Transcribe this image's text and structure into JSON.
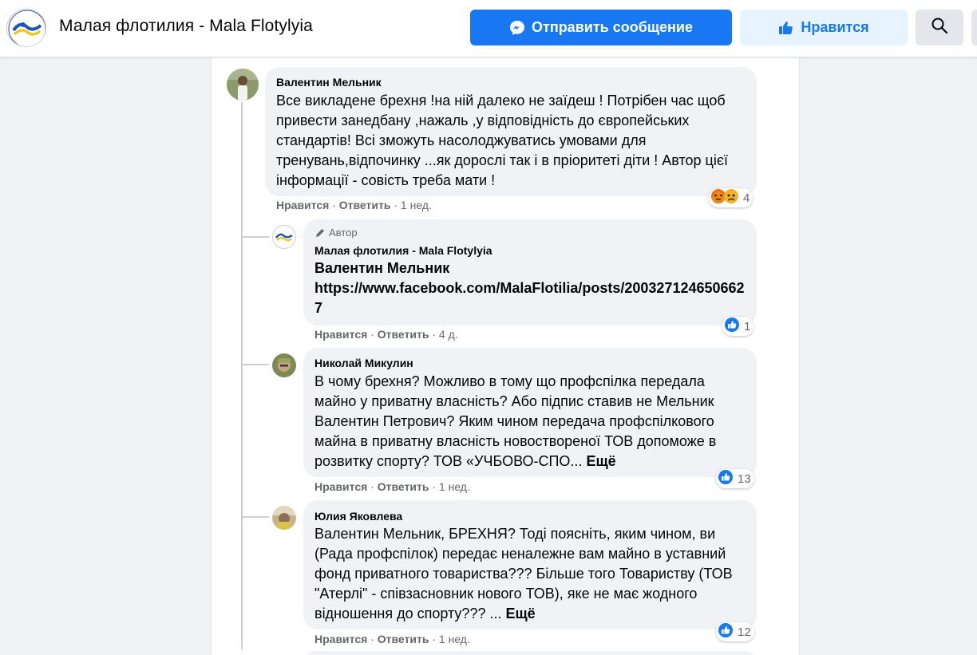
{
  "header": {
    "page_name": "Малая флотилия - Mala Flotylyia",
    "send_message_label": "Отправить сообщение",
    "like_label": "Нравится",
    "accent_color": "#1877f2"
  },
  "comments": [
    {
      "author": "Валентин Мельник",
      "text": "Все викладене брехня !на ній далеко не заїдеш ! Потрібен час щоб привести занедбану ,нажаль ,у відповідність до європейських стандартів! Всі зможуть насолоджуватись умовами для тренувань,відпочинку ...як дорослі так і в пріоритеті діти ! Автор цієї інформації - совість треба мати !",
      "like_action": "Нравится",
      "reply_action": "Ответить",
      "time": "1 нед.",
      "reactions": [
        "angry",
        "sad"
      ],
      "reaction_count": "4"
    },
    {
      "badge": "Автор",
      "author": "Малая флотилия - Mala Flotylyia",
      "mention": "Валентин Мельник",
      "link": "https://www.facebook.com/MalaFlotilia/posts/2003271246506627",
      "like_action": "Нравится",
      "reply_action": "Ответить",
      "time": "4 д.",
      "reactions": [
        "like"
      ],
      "reaction_count": "1"
    },
    {
      "author": "Николай Микулин",
      "text": "В чому брехня? Можливо в тому що профспілка передала майно у приватну власність? Або підпис ставив не Мельник Валентин Петрович? Яким чином передача профспілкового майна в приватну власність новоствореної ТОВ допоможе в розвитку спорту? ТОВ «УЧБОВО-СПО...",
      "see_more": "Ещё",
      "like_action": "Нравится",
      "reply_action": "Ответить",
      "time": "1 нед.",
      "reactions": [
        "like"
      ],
      "reaction_count": "13"
    },
    {
      "author": "Юлия Яковлева",
      "text": "Валентин Мельник, БРЕХНЯ? Тоді поясніть, яким чином, ви (Рада профспілок) передає неналежне вам майно в уставний фонд приватного товариства??? Більше того Товариству (ТОВ \"Атерлі\" - співзасновник нового ТОВ), яке не має жодного відношення до спорту??? ...",
      "see_more": "Ещё",
      "like_action": "Нравится",
      "reply_action": "Ответить",
      "time": "1 нед.",
      "reactions": [
        "like"
      ],
      "reaction_count": "12"
    }
  ]
}
